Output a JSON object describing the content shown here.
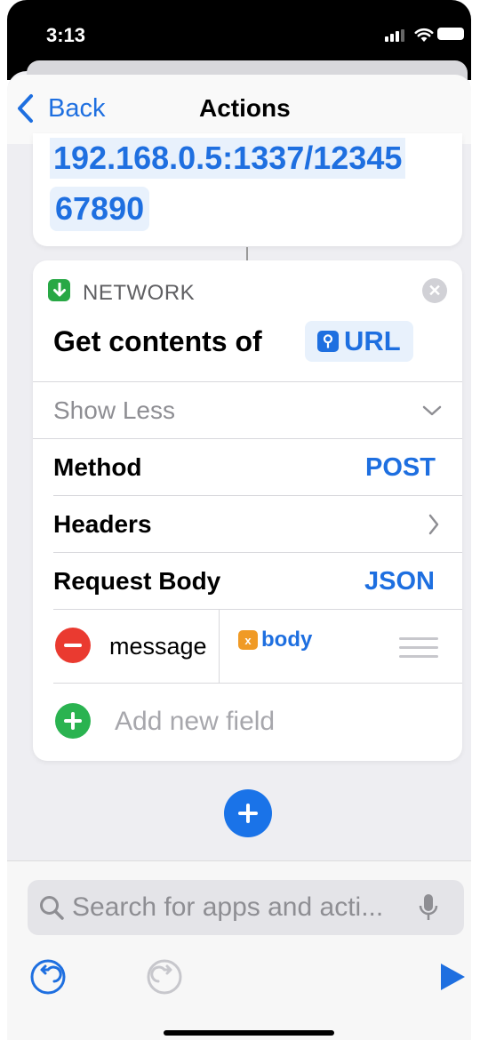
{
  "status_bar": {
    "time": "3:13"
  },
  "nav": {
    "back_label": "Back",
    "title": "Actions"
  },
  "previous_action": {
    "url_line_1": "192.168.0.5:1337/12345",
    "url_line_2": "67890"
  },
  "action": {
    "category": "NETWORK",
    "title": "Get contents of",
    "url_token": "URL",
    "show_less": "Show Less",
    "method_label": "Method",
    "method_value": "POST",
    "headers_label": "Headers",
    "request_body_label": "Request Body",
    "request_body_value": "JSON",
    "fields": [
      {
        "key": "message",
        "value": "body"
      }
    ],
    "add_field_placeholder": "Add new field"
  },
  "toolbar": {
    "search_placeholder": "Search for apps and acti..."
  },
  "colors": {
    "accent": "#1e6fe0",
    "network_green": "#28a845",
    "delete_red": "#ea3a30",
    "add_green": "#2ab350",
    "variable_orange": "#f09a25"
  },
  "icons": [
    "back-chevron-icon",
    "network-download-icon",
    "close-icon",
    "link-icon",
    "chevron-down-icon",
    "chevron-right-icon",
    "minus-icon",
    "variable-icon",
    "drag-handle-icon",
    "plus-icon",
    "search-icon",
    "microphone-icon",
    "undo-icon",
    "redo-icon",
    "play-icon"
  ]
}
